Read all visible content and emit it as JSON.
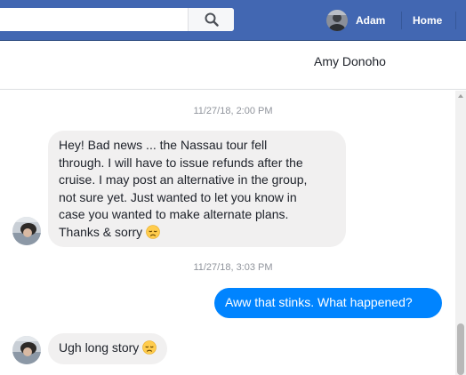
{
  "topbar": {
    "profile_name": "Adam",
    "home_label": "Home",
    "brand_color": "#4267b2"
  },
  "search": {
    "value": "",
    "placeholder": ""
  },
  "conversation": {
    "contact_name": "Amy Donoho",
    "messages": [
      {
        "type": "timestamp",
        "text": "11/27/18, 2:00 PM"
      },
      {
        "type": "incoming",
        "lines": [
          "Hey! Bad news ... the Nassau tour fell",
          "through. I will have to issue refunds after the",
          "cruise. I may post an alternative in the group,",
          "not sure yet. Just wanted to let you know in",
          "case you wanted to make alternate plans.",
          "Thanks & sorry"
        ],
        "emoji": "disappointed-face"
      },
      {
        "type": "timestamp",
        "text": "11/27/18, 3:03 PM"
      },
      {
        "type": "outgoing",
        "text": "Aww that stinks. What happened?"
      },
      {
        "type": "incoming",
        "text": "Ugh long story",
        "emoji": "disappointed-face"
      }
    ]
  },
  "colors": {
    "outgoing_bubble": "#0084ff",
    "incoming_bubble": "#f1f0f0",
    "timestamp": "#90949c"
  }
}
